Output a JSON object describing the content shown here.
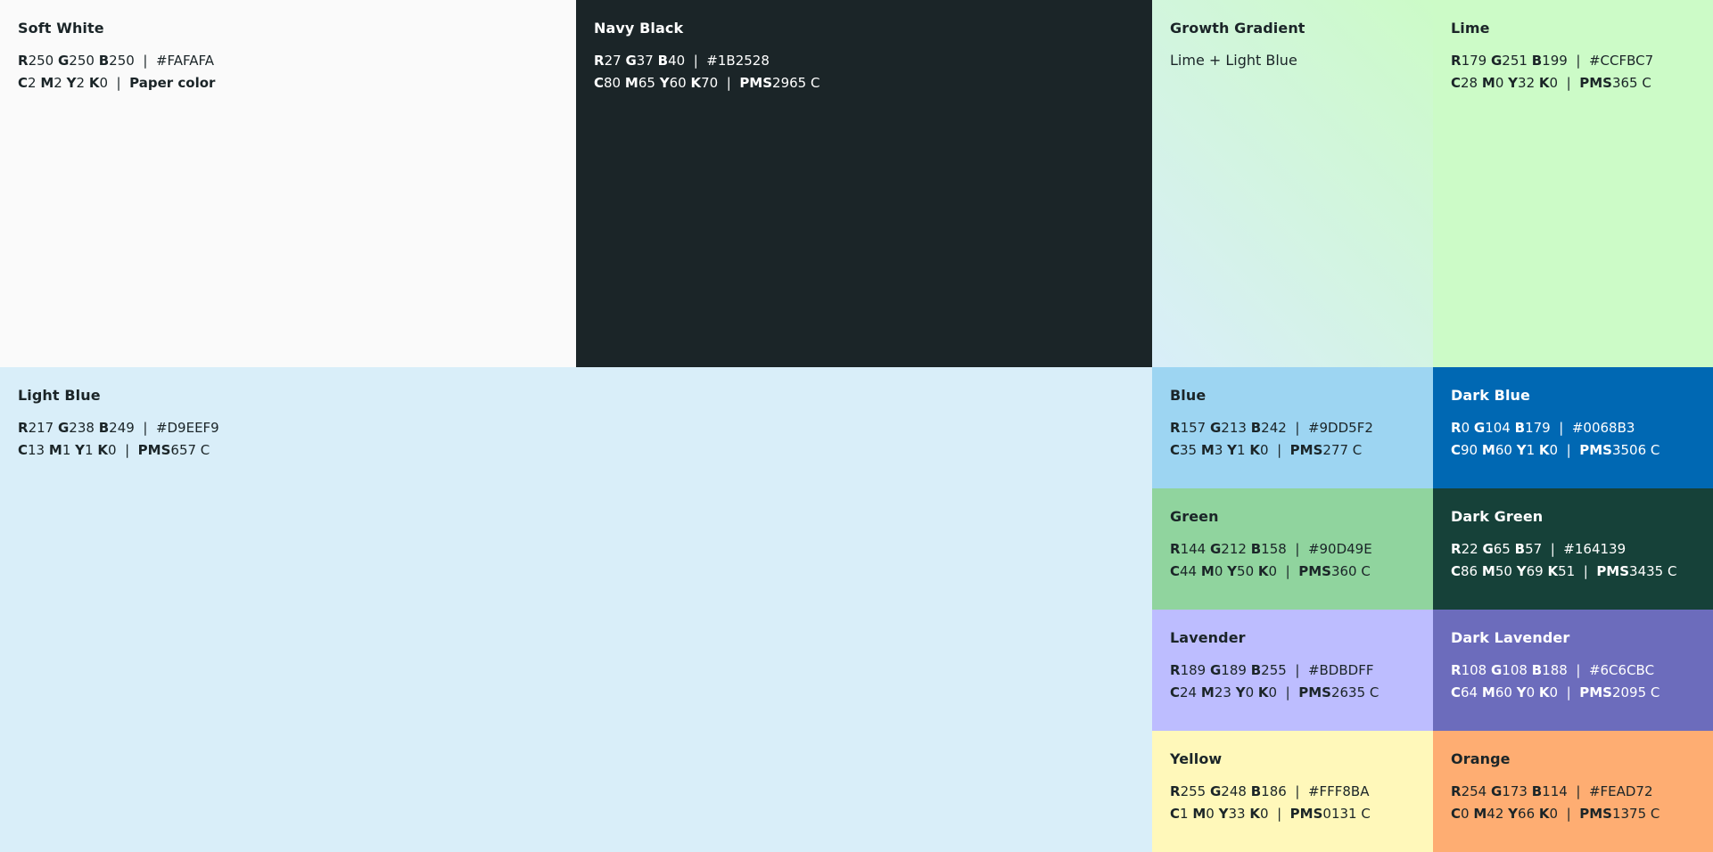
{
  "swatches": [
    {
      "id": "soft-white",
      "name": "Soft White",
      "hex_color": "#FAFAFA",
      "text": "light",
      "rgb": {
        "r": "250",
        "g": "250",
        "b": "250",
        "hex": "#FAFAFA"
      },
      "cmyk": {
        "c": "2",
        "m": "2",
        "y": "2",
        "k": "0"
      },
      "extra": "Paper color"
    },
    {
      "id": "navy-black",
      "name": "Navy Black",
      "hex_color": "#1B2528",
      "text": "dark",
      "rgb": {
        "r": "27",
        "g": "37",
        "b": "40",
        "hex": "#1B2528"
      },
      "cmyk": {
        "c": "80",
        "m": "65",
        "y": "60",
        "k": "70"
      },
      "pms": "2965 C"
    },
    {
      "id": "growth-gradient",
      "name": "Growth Gradient",
      "subtitle": "Lime + Light Blue"
    },
    {
      "id": "lime",
      "name": "Lime",
      "hex_color": "#CCFBC7",
      "text": "light",
      "rgb": {
        "r": "179",
        "g": "251",
        "b": "199",
        "hex": "#CCFBC7"
      },
      "cmyk": {
        "c": "28",
        "m": "0",
        "y": "32",
        "k": "0"
      },
      "pms": "365 C"
    },
    {
      "id": "light-blue",
      "name": "Light Blue",
      "hex_color": "#D9EEF9",
      "text": "light",
      "rgb": {
        "r": "217",
        "g": "238",
        "b": "249",
        "hex": "#D9EEF9"
      },
      "cmyk": {
        "c": "13",
        "m": "1",
        "y": "1",
        "k": "0"
      },
      "pms": "657 C"
    },
    {
      "id": "blue",
      "name": "Blue",
      "hex_color": "#9DD5F2",
      "text": "light",
      "rgb": {
        "r": "157",
        "g": "213",
        "b": "242",
        "hex": "#9DD5F2"
      },
      "cmyk": {
        "c": "35",
        "m": "3",
        "y": "1",
        "k": "0"
      },
      "pms": "277 C"
    },
    {
      "id": "dark-blue",
      "name": "Dark Blue",
      "hex_color": "#0068B3",
      "text": "dark",
      "rgb": {
        "r": "0",
        "g": "104",
        "b": "179",
        "hex": "#0068B3"
      },
      "cmyk": {
        "c": "90",
        "m": "60",
        "y": "1",
        "k": "0"
      },
      "pms": "3506 C"
    },
    {
      "id": "green",
      "name": "Green",
      "hex_color": "#90D49E",
      "text": "light",
      "rgb": {
        "r": "144",
        "g": "212",
        "b": "158",
        "hex": "#90D49E"
      },
      "cmyk": {
        "c": "44",
        "m": "0",
        "y": "50",
        "k": "0"
      },
      "pms": "360 C"
    },
    {
      "id": "dark-green",
      "name": "Dark Green",
      "hex_color": "#164139",
      "text": "dark",
      "rgb": {
        "r": "22",
        "g": "65",
        "b": "57",
        "hex": "#164139"
      },
      "cmyk": {
        "c": "86",
        "m": "50",
        "y": "69",
        "k": "51"
      },
      "pms": "3435 C"
    },
    {
      "id": "lavender",
      "name": "Lavender",
      "hex_color": "#BDBDFF",
      "text": "light",
      "rgb": {
        "r": "189",
        "g": "189",
        "b": "255",
        "hex": "#BDBDFF"
      },
      "cmyk": {
        "c": "24",
        "m": "23",
        "y": "0",
        "k": "0"
      },
      "pms": "2635 C"
    },
    {
      "id": "dark-lavender",
      "name": "Dark Lavender",
      "hex_color": "#6C6CBC",
      "text": "dark",
      "rgb": {
        "r": "108",
        "g": "108",
        "b": "188",
        "hex": "#6C6CBC"
      },
      "cmyk": {
        "c": "64",
        "m": "60",
        "y": "0",
        "k": "0"
      },
      "pms": "2095 C"
    },
    {
      "id": "yellow",
      "name": "Yellow",
      "hex_color": "#FFF8BA",
      "text": "light",
      "rgb": {
        "r": "255",
        "g": "248",
        "b": "186",
        "hex": "#FFF8BA"
      },
      "cmyk": {
        "c": "1",
        "m": "0",
        "y": "33",
        "k": "0"
      },
      "pms": "0131 C"
    },
    {
      "id": "orange",
      "name": "Orange",
      "hex_color": "#FEAD72",
      "text": "light",
      "rgb": {
        "r": "254",
        "g": "173",
        "b": "114",
        "hex": "#FEAD72"
      },
      "cmyk": {
        "c": "0",
        "m": "42",
        "y": "66",
        "k": "0"
      },
      "pms": "1375 C"
    }
  ]
}
